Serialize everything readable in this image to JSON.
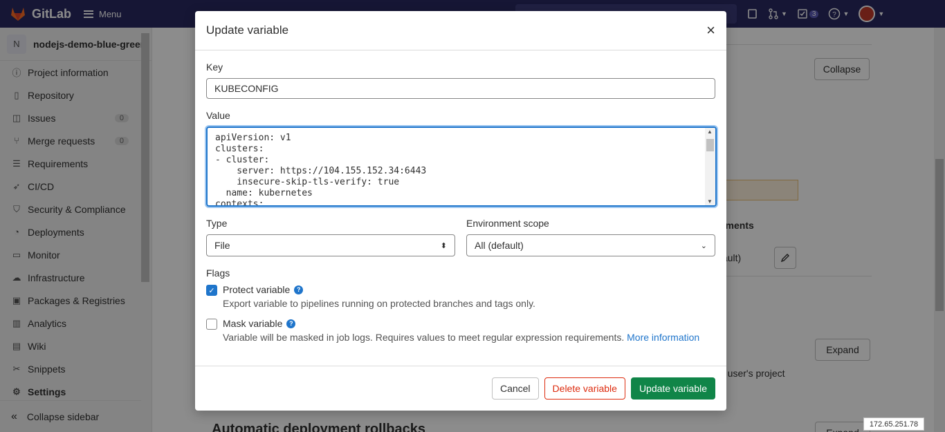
{
  "navbar": {
    "brand": "GitLab",
    "menu_label": "Menu",
    "todo_count": "3"
  },
  "sidebar": {
    "project_initial": "N",
    "project_name": "nodejs-demo-blue-green",
    "items": [
      {
        "label": "Project information",
        "icon": "info-icon"
      },
      {
        "label": "Repository",
        "icon": "doc-icon"
      },
      {
        "label": "Issues",
        "icon": "issues-icon",
        "count": "0"
      },
      {
        "label": "Merge requests",
        "icon": "merge-request-icon",
        "count": "0"
      },
      {
        "label": "Requirements",
        "icon": "requirements-icon"
      },
      {
        "label": "CI/CD",
        "icon": "rocket-icon"
      },
      {
        "label": "Security & Compliance",
        "icon": "shield-icon"
      },
      {
        "label": "Deployments",
        "icon": "deployments-icon"
      },
      {
        "label": "Monitor",
        "icon": "monitor-icon"
      },
      {
        "label": "Infrastructure",
        "icon": "cloud-icon"
      },
      {
        "label": "Packages & Registries",
        "icon": "package-icon"
      },
      {
        "label": "Analytics",
        "icon": "chart-icon"
      },
      {
        "label": "Wiki",
        "icon": "book-icon"
      },
      {
        "label": "Snippets",
        "icon": "snippet-icon"
      },
      {
        "label": "Settings",
        "icon": "gear-icon"
      }
    ],
    "collapse_label": "Collapse sidebar"
  },
  "background": {
    "collapse_label": "Collapse",
    "expand_label_1": "Expand",
    "expand_label_2": "Expand",
    "env_col_fragment": "nments",
    "scope_fragment": "fault)",
    "desc_fragment": "a user's project",
    "section_heading_fragment": "Automatic deployment rollbacks"
  },
  "modal": {
    "title": "Update variable",
    "key_label": "Key",
    "key_value": "KUBECONFIG",
    "value_label": "Value",
    "value_text": "apiVersion: v1\nclusters:\n- cluster:\n    server: https://104.155.152.34:6443\n    insecure-skip-tls-verify: true\n  name: kubernetes\ncontexts:",
    "type_label": "Type",
    "type_value": "File",
    "env_scope_label": "Environment scope",
    "env_scope_value": "All (default)",
    "flags_label": "Flags",
    "protect_label": "Protect variable",
    "protect_checked": true,
    "protect_desc": "Export variable to pipelines running on protected branches and tags only.",
    "mask_label": "Mask variable",
    "mask_checked": false,
    "mask_desc": "Variable will be masked in job logs. Requires values to meet regular expression requirements.",
    "more_info_link": "More information",
    "cancel_label": "Cancel",
    "delete_label": "Delete variable",
    "update_label": "Update variable"
  },
  "ip_tag": "172.65.251.78"
}
